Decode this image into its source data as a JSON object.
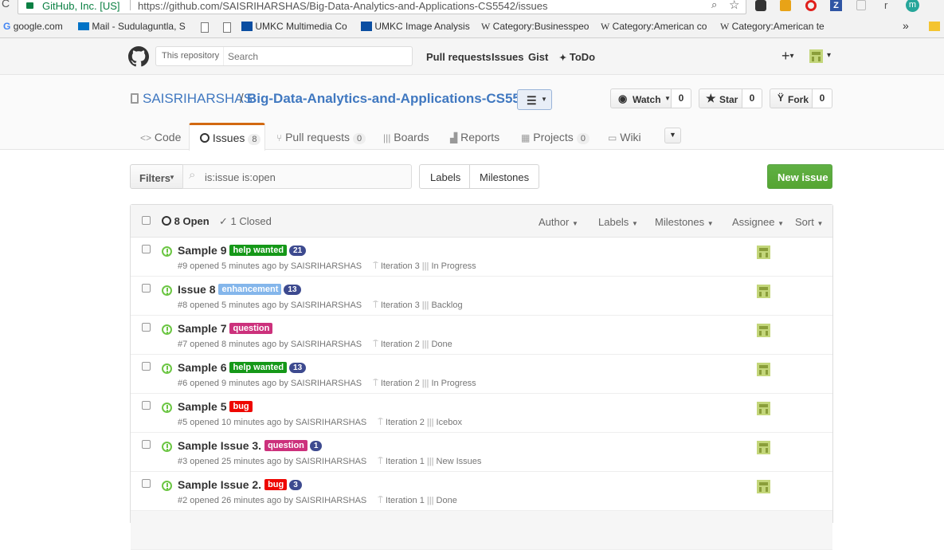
{
  "browser": {
    "tab_site": "GitHub, Inc. [US]",
    "url": "https://github.com/SAISRIHARSHAS/Big-Data-Analytics-and-Applications-CS5542/issues",
    "profile_letter": "r",
    "profile_avatar": "m",
    "bookmarks": [
      {
        "label": "google.com",
        "icon": "google-icon"
      },
      {
        "label": "Mail - Sudulaguntla, S",
        "icon": "mail-icon"
      },
      {
        "label": "",
        "icon": "page-icon"
      },
      {
        "label": "",
        "icon": "page-icon"
      },
      {
        "label": "UMKC Multimedia Co",
        "icon": "umkc-icon"
      },
      {
        "label": "UMKC Image Analysis",
        "icon": "umkc-icon"
      },
      {
        "label": "Category:Businesspeo",
        "icon": "wikipedia-icon"
      },
      {
        "label": "Category:American co",
        "icon": "wikipedia-icon"
      },
      {
        "label": "Category:American te",
        "icon": "wikipedia-icon"
      }
    ],
    "bookmarks_overflow": "»"
  },
  "header": {
    "scope_label": "This repository",
    "search_placeholder": "Search",
    "nav": [
      "Pull requests",
      "Issues",
      "Gist",
      "ToDo"
    ],
    "plus": "+",
    "caret": "▾"
  },
  "repo": {
    "owner": "SAISRIHARSHAS",
    "separator": "/",
    "name": "Big-Data-Analytics-and-Applications-CS5542",
    "watch_label": "Watch",
    "watch_count": "0",
    "star_label": "Star",
    "star_count": "0",
    "fork_label": "Fork",
    "fork_count": "0"
  },
  "tabs": [
    {
      "label": "Code",
      "count": ""
    },
    {
      "label": "Issues",
      "count": "8"
    },
    {
      "label": "Pull requests",
      "count": "0"
    },
    {
      "label": "Boards",
      "count": ""
    },
    {
      "label": "Reports",
      "count": ""
    },
    {
      "label": "Projects",
      "count": "0"
    },
    {
      "label": "Wiki",
      "count": ""
    }
  ],
  "toolbar": {
    "filters_label": "Filters",
    "filter_value": "is:issue is:open",
    "labels_label": "Labels",
    "milestones_label": "Milestones",
    "new_issue_label": "New issue"
  },
  "list_header": {
    "open_label": "8 Open",
    "closed_label": "1 Closed",
    "filters": [
      "Author",
      "Labels",
      "Milestones",
      "Assignee",
      "Sort"
    ]
  },
  "issues": [
    {
      "title": "Sample 9",
      "label": "help wanted",
      "label_color": "#159818",
      "badge": "21",
      "meta": "#9 opened 5 minutes ago by SAISRIHARSHAS",
      "iteration": "Iteration 3",
      "status": "In Progress"
    },
    {
      "title": "Issue 8",
      "label": "enhancement",
      "label_color": "#84b6eb",
      "badge": "13",
      "meta": "#8 opened 5 minutes ago by SAISRIHARSHAS",
      "iteration": "Iteration 3",
      "status": "Backlog"
    },
    {
      "title": "Sample 7",
      "label": "question",
      "label_color": "#cc317c",
      "badge": "",
      "meta": "#7 opened 8 minutes ago by SAISRIHARSHAS",
      "iteration": "Iteration 2",
      "status": "Done"
    },
    {
      "title": "Sample 6",
      "label": "help wanted",
      "label_color": "#159818",
      "badge": "13",
      "meta": "#6 opened 9 minutes ago by SAISRIHARSHAS",
      "iteration": "Iteration 2",
      "status": "In Progress"
    },
    {
      "title": "Sample 5",
      "label": "bug",
      "label_color": "#ee0701",
      "badge": "",
      "meta": "#5 opened 10 minutes ago by SAISRIHARSHAS",
      "iteration": "Iteration 2",
      "status": "Icebox"
    },
    {
      "title": "Sample Issue 3.",
      "label": "question",
      "label_color": "#cc317c",
      "badge": "1",
      "meta": "#3 opened 25 minutes ago by SAISRIHARSHAS",
      "iteration": "Iteration 1",
      "status": "New Issues"
    },
    {
      "title": "Sample Issue 2.",
      "label": "bug",
      "label_color": "#ee0701",
      "badge": "3",
      "meta": "#2 opened 26 minutes ago by SAISRIHARSHAS",
      "iteration": "Iteration 1",
      "status": "Done"
    }
  ]
}
